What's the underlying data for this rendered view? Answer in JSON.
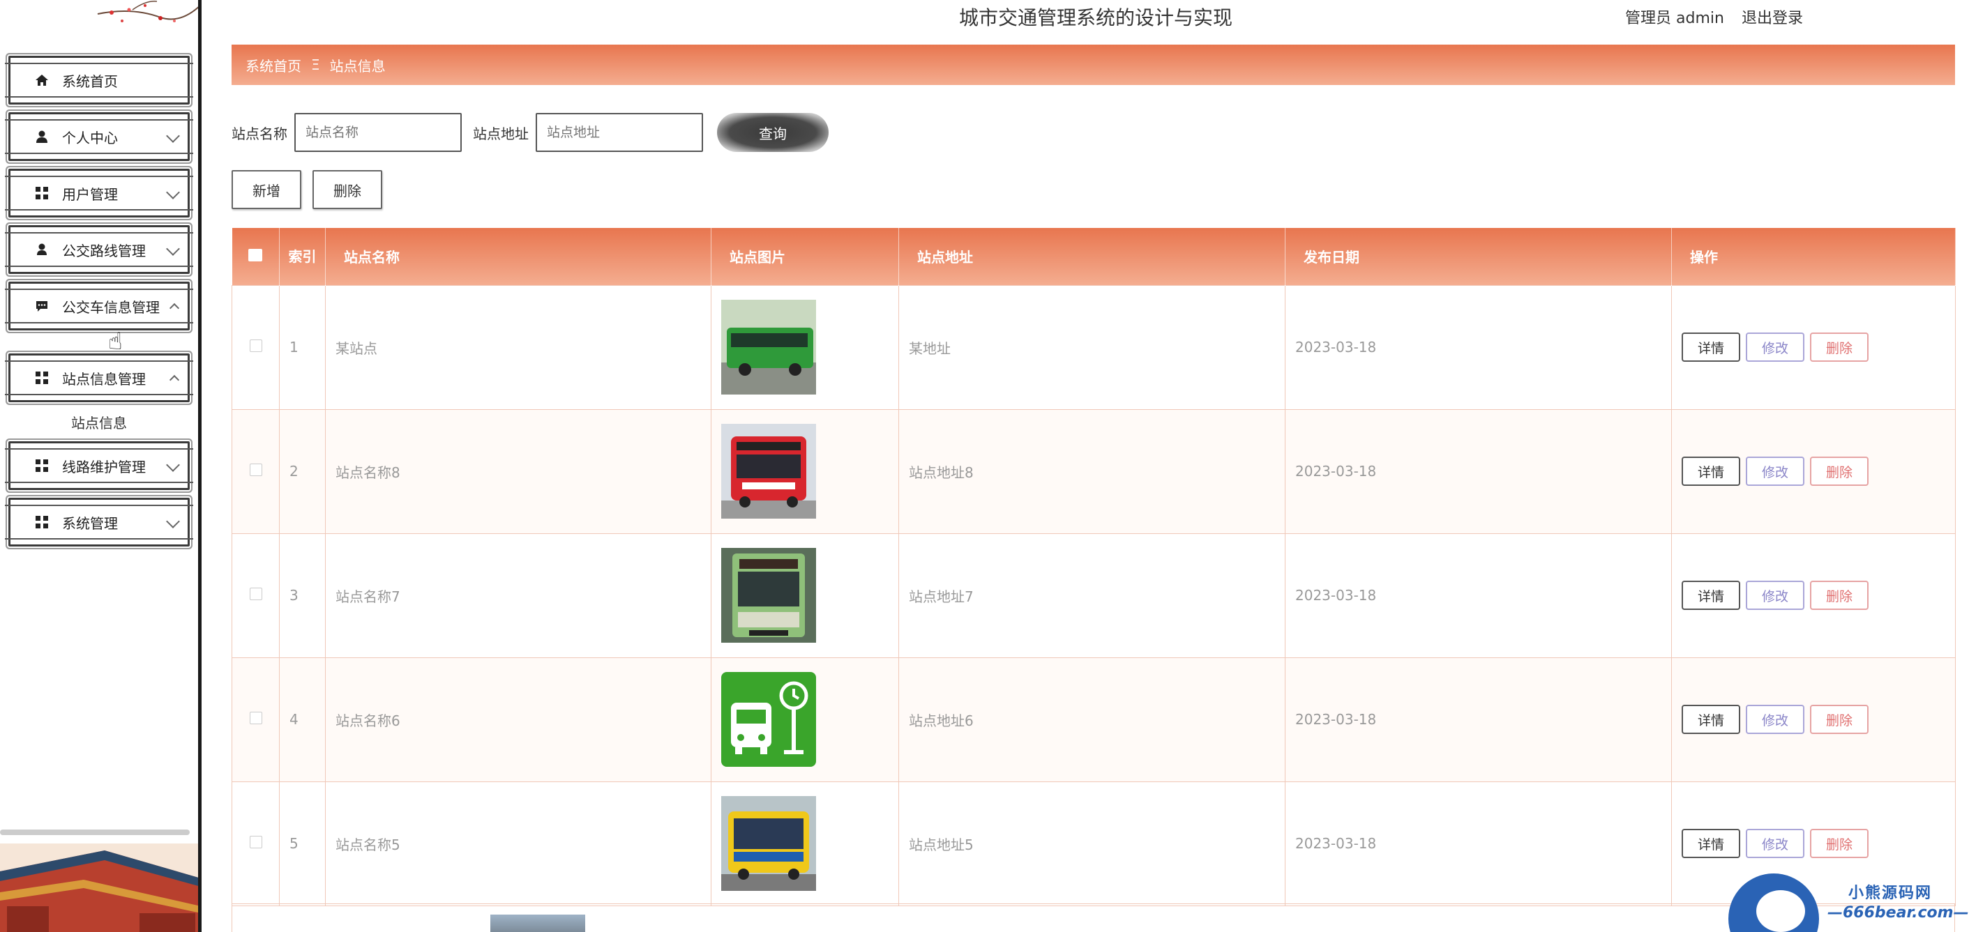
{
  "app": {
    "title": "城市交通管理系统的设计与实现"
  },
  "user": {
    "role_name": "管理员 admin",
    "logout": "退出登录"
  },
  "sidebar": {
    "items": [
      {
        "label": "系统首页",
        "icon": "home-icon"
      },
      {
        "label": "个人中心",
        "icon": "person-icon"
      },
      {
        "label": "用户管理",
        "icon": "grid-icon"
      },
      {
        "label": "公交路线管理",
        "icon": "person-icon"
      },
      {
        "label": "公交车信息管理",
        "icon": "chat-icon"
      },
      {
        "label": "站点信息管理",
        "icon": "grid-icon"
      },
      {
        "label": "线路维护管理",
        "icon": "grid-icon"
      },
      {
        "label": "系统管理",
        "icon": "grid-icon"
      }
    ],
    "submenu": {
      "label": "站点信息"
    }
  },
  "breadcrumb": {
    "home": "系统首页",
    "separator": "Ξ",
    "current": "站点信息"
  },
  "search": {
    "name_label": "站点名称",
    "name_placeholder": "站点名称",
    "addr_label": "站点地址",
    "addr_placeholder": "站点地址",
    "query": "查询"
  },
  "actions": {
    "add": "新增",
    "delete": "删除"
  },
  "table": {
    "headers": {
      "index": "索引",
      "name": "站点名称",
      "image": "站点图片",
      "address": "站点地址",
      "date": "发布日期",
      "ops": "操作"
    },
    "rows": [
      {
        "index": "1",
        "name": "某站点",
        "address": "某地址",
        "date": "2023-03-18",
        "image": "green-bus"
      },
      {
        "index": "2",
        "name": "站点名称8",
        "address": "站点地址8",
        "date": "2023-03-18",
        "image": "red-bus"
      },
      {
        "index": "3",
        "name": "站点名称7",
        "address": "站点地址7",
        "date": "2023-03-18",
        "image": "green-bus-front"
      },
      {
        "index": "4",
        "name": "站点名称6",
        "address": "站点地址6",
        "date": "2023-03-18",
        "image": "bus-stop-icon"
      },
      {
        "index": "5",
        "name": "站点名称5",
        "address": "站点地址5",
        "date": "2023-03-18",
        "image": "yellow-bus"
      }
    ],
    "ops": {
      "detail": "详情",
      "edit": "修改",
      "delete": "删除"
    }
  },
  "watermark": {
    "line1": "小熊源码网",
    "line2": "—666bear.com—"
  },
  "colors": {
    "accent": "#e8764f",
    "accent_light": "#f4ad90",
    "edit": "#8a85c8",
    "delete": "#e07070"
  }
}
